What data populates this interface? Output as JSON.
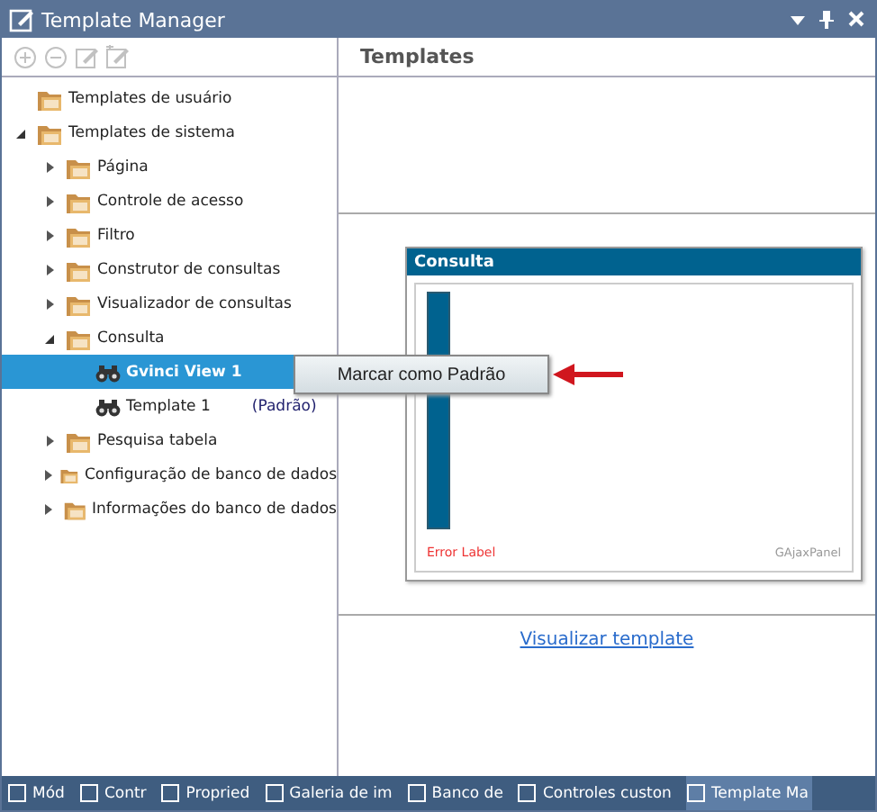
{
  "window": {
    "title": "Template Manager"
  },
  "toolbar": {
    "buttons": [
      {
        "kind": "add",
        "disabled": true
      },
      {
        "kind": "remove",
        "disabled": true
      },
      {
        "kind": "edit",
        "disabled": true
      },
      {
        "kind": "edit-add",
        "disabled": true
      }
    ]
  },
  "tree": [
    {
      "label": "Templates de usuário",
      "kind": "folder"
    },
    {
      "label": "Templates de sistema",
      "kind": "folder",
      "expanded": true,
      "children": [
        {
          "label": "Página",
          "kind": "folder",
          "expanded": false
        },
        {
          "label": "Controle de acesso",
          "kind": "folder",
          "expanded": false
        },
        {
          "label": "Filtro",
          "kind": "folder",
          "expanded": false
        },
        {
          "label": "Construtor de consultas",
          "kind": "folder",
          "expanded": false
        },
        {
          "label": "Visualizador de consultas",
          "kind": "folder",
          "expanded": false
        },
        {
          "label": "Consulta",
          "kind": "folder",
          "expanded": true,
          "children": [
            {
              "label": "Gvinci View 1",
              "kind": "template",
              "selected": true
            },
            {
              "label": "Template 1",
              "kind": "template",
              "selected": false,
              "badge": "(Padrão)"
            }
          ]
        },
        {
          "label": "Pesquisa tabela",
          "kind": "folder",
          "expanded": false
        },
        {
          "label": "Configuração de banco de dados",
          "kind": "folder",
          "expanded": false
        },
        {
          "label": "Informações do banco de dados",
          "kind": "folder",
          "expanded": false
        }
      ]
    }
  ],
  "context_menu": {
    "items": [
      "Marcar como Padrão"
    ]
  },
  "preview": {
    "header": "Templates",
    "panel_title": "Consulta",
    "error_label": "Error Label",
    "panel_type": "GAjaxPanel",
    "link": "Visualizar template"
  },
  "taskbar": [
    {
      "label": "Mód",
      "selected": false
    },
    {
      "label": "Contr",
      "selected": false
    },
    {
      "label": "Propried",
      "selected": false
    },
    {
      "label": "Galeria de im",
      "selected": false
    },
    {
      "label": "Banco de",
      "selected": false
    },
    {
      "label": "Controles custon",
      "selected": false
    },
    {
      "label": "Template Ma",
      "selected": true
    }
  ]
}
